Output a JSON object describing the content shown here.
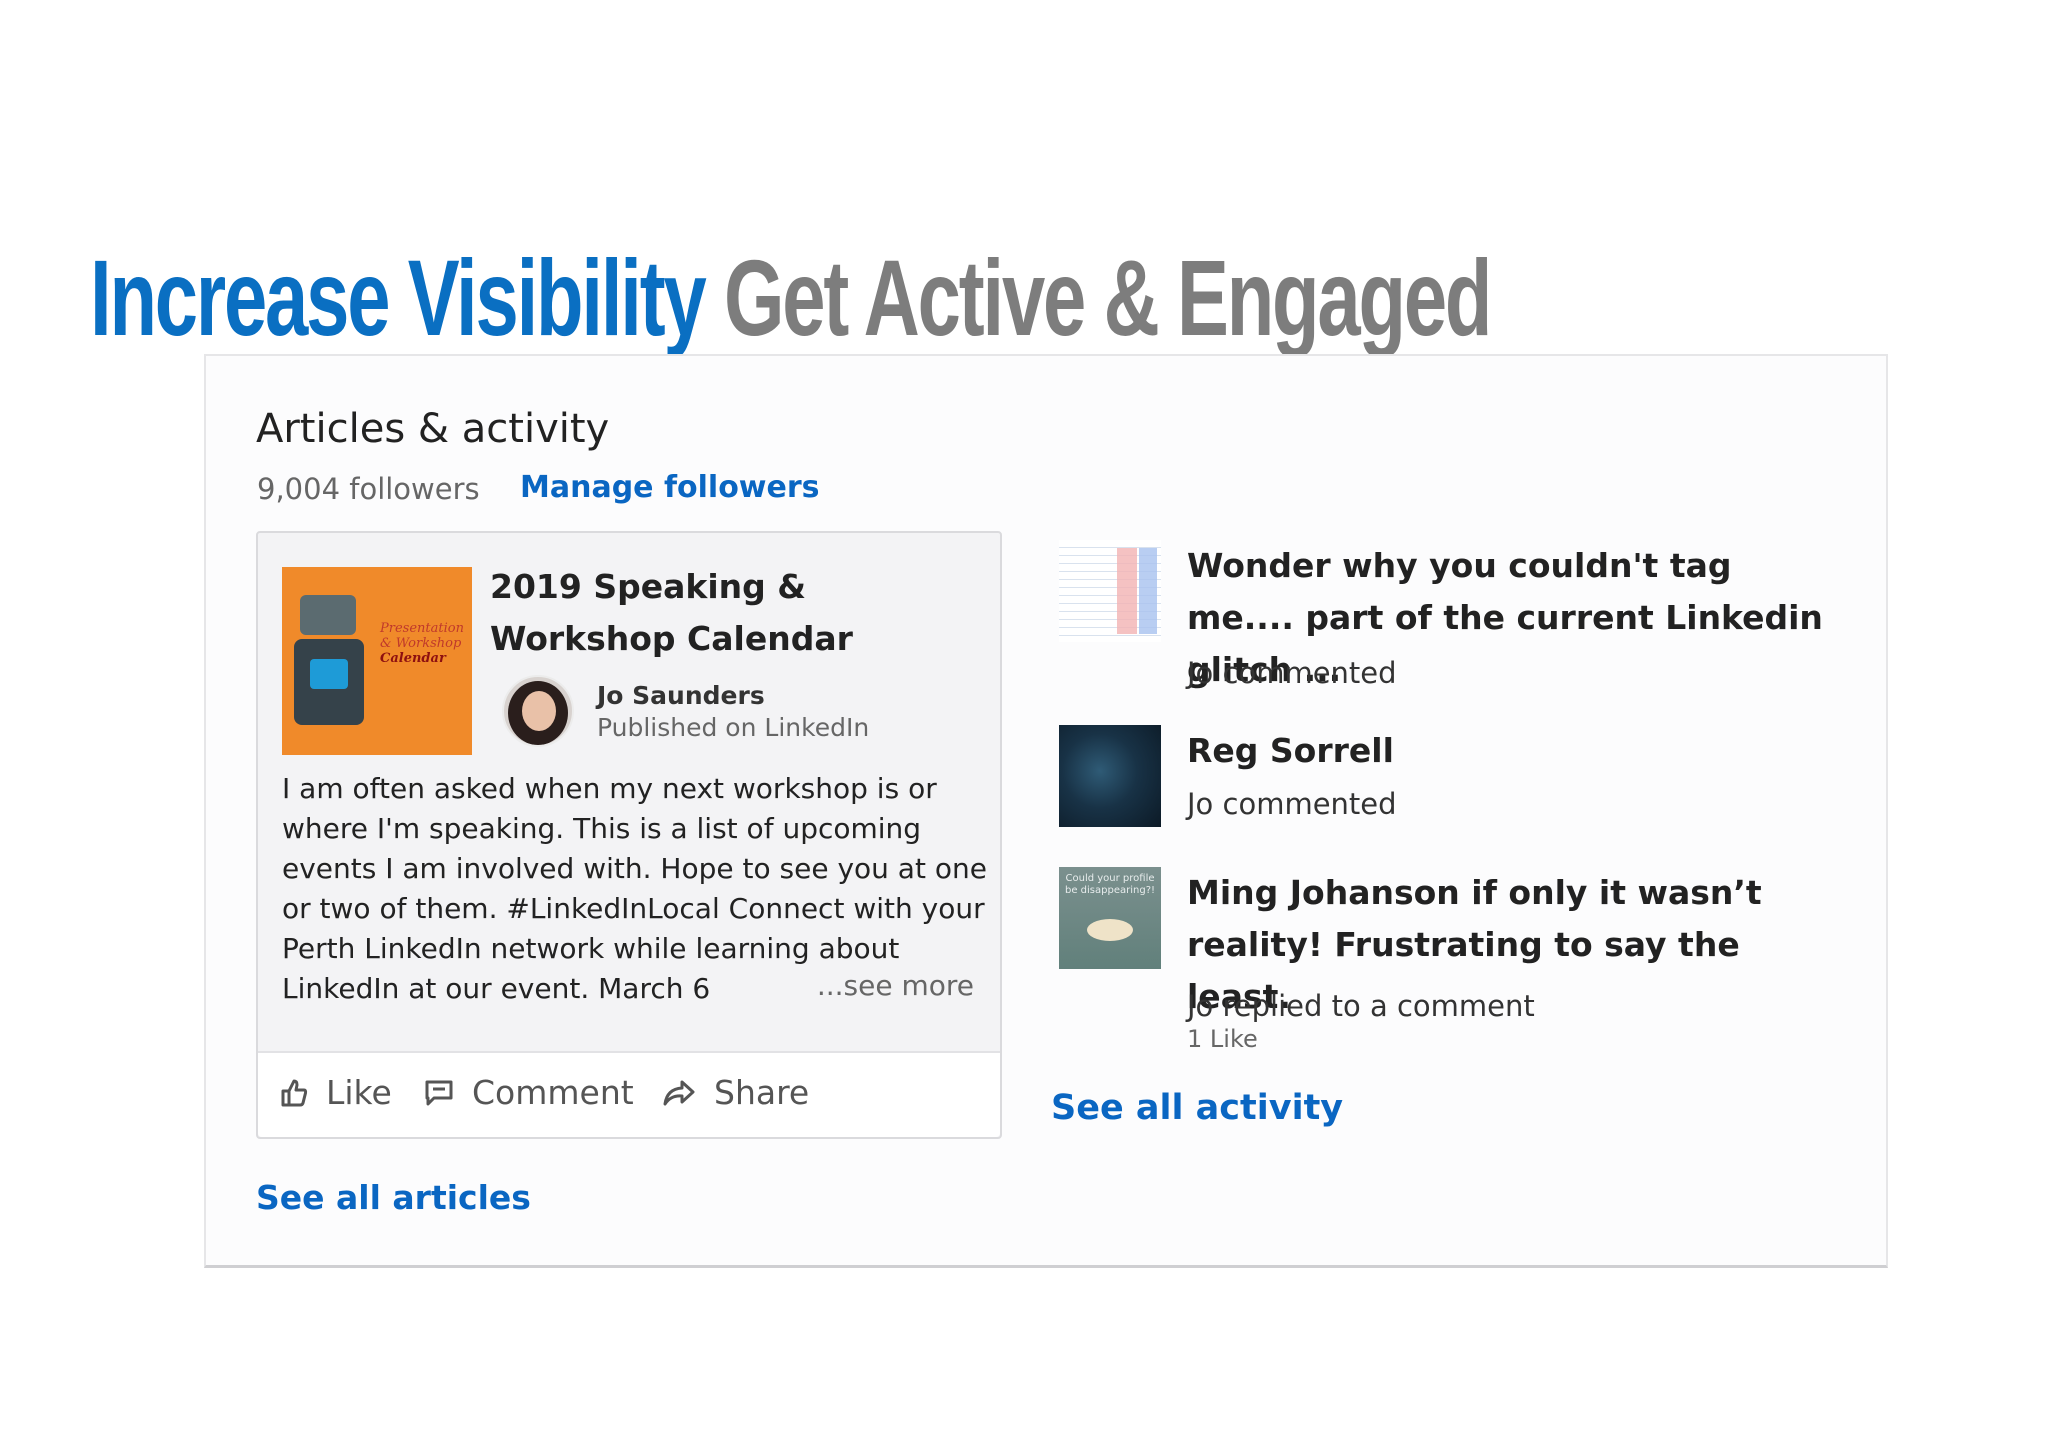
{
  "slide": {
    "title_accent": "Increase Visibility",
    "title_rest": "Get Active & Engaged"
  },
  "section": {
    "title": "Articles & activity",
    "followers": "9,004 followers",
    "manage_followers": "Manage followers"
  },
  "article": {
    "title": "2019 Speaking & Workshop Calendar",
    "author": "Jo Saunders",
    "published": "Published on LinkedIn",
    "thumb_text": [
      "Presentation",
      "& Workshop",
      "Calendar"
    ],
    "body": "I am often asked when my next workshop is or where I'm speaking. This is a list of upcoming events I am involved with. Hope to see you at one or two of them. #LinkedInLocal Connect with your Perth LinkedIn network while learning about LinkedIn at our event. March 6",
    "see_more": "...see more",
    "actions": {
      "like": "Like",
      "comment": "Comment",
      "share": "Share"
    }
  },
  "see_all_articles": "See all articles",
  "activity": [
    {
      "title": "Wonder why you couldn't tag me.... part of the current Linkedin glitch ...",
      "meta": "Jo commented",
      "thumb": "spreadsheet-thumbnail"
    },
    {
      "title": "Reg Sorrell",
      "meta": "Jo commented",
      "thumb": "dark-photo-thumbnail"
    },
    {
      "title": "Ming Johanson if only it wasn’t reality! Frustrating to say the least.",
      "meta": "Jo replied to a comment",
      "likes": "1 Like",
      "thumb": "sky-thumbnail",
      "thumb_text": "Could your profile be disappearing?!"
    }
  ],
  "see_all_activity": "See all activity",
  "colors": {
    "accent": "#0a6fc2",
    "link": "#0a66c2",
    "title_gray": "#7d7d7d"
  }
}
